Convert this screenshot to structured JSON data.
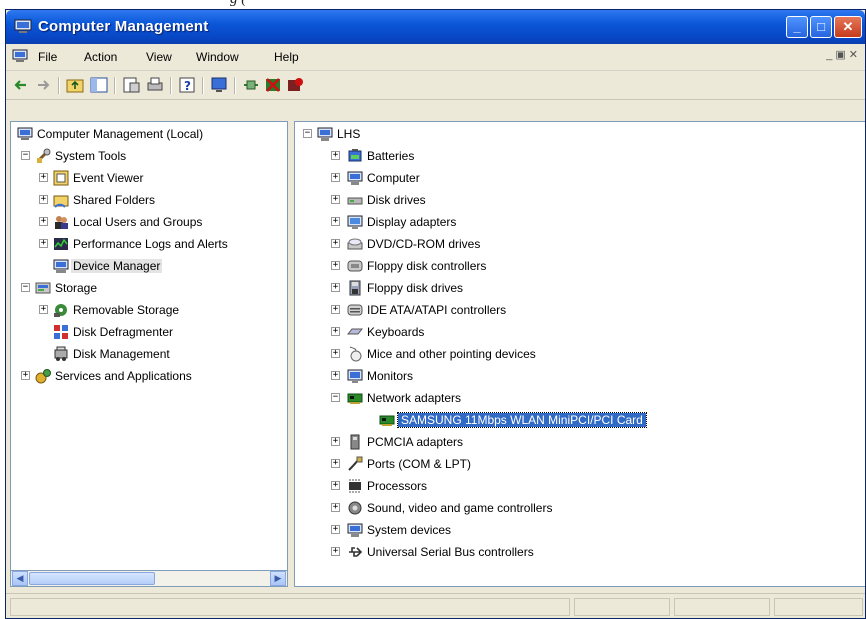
{
  "window": {
    "title": "Computer Management"
  },
  "menu": [
    "File",
    "Action",
    "View",
    "Window",
    "Help"
  ],
  "toolbar_icons": [
    "back-icon",
    "forward-icon",
    "up-folder-icon",
    "show-hide-tree-icon",
    "properties-icon",
    "print-icon",
    "help-icon",
    "scan-hardware-icon",
    "update-driver-icon",
    "uninstall-icon",
    "disable-icon"
  ],
  "left_tree": [
    {
      "label": "Computer Management (Local)",
      "icon": "computer-management-icon",
      "expander": ""
    },
    {
      "label": "System Tools",
      "icon": "system-tools-icon",
      "expander": "−"
    },
    {
      "label": "Event Viewer",
      "icon": "event-viewer-icon",
      "expander": "+"
    },
    {
      "label": "Shared Folders",
      "icon": "shared-folders-icon",
      "expander": "+"
    },
    {
      "label": "Local Users and Groups",
      "icon": "users-icon",
      "expander": "+"
    },
    {
      "label": "Performance Logs and Alerts",
      "icon": "performance-icon",
      "expander": "+"
    },
    {
      "label": "Device Manager",
      "icon": "device-manager-icon",
      "expander": "",
      "selected": true
    },
    {
      "label": "Storage",
      "icon": "storage-icon",
      "expander": "−"
    },
    {
      "label": "Removable Storage",
      "icon": "removable-storage-icon",
      "expander": "+"
    },
    {
      "label": "Disk Defragmenter",
      "icon": "defrag-icon",
      "expander": ""
    },
    {
      "label": "Disk Management",
      "icon": "disk-management-icon",
      "expander": ""
    },
    {
      "label": "Services and Applications",
      "icon": "services-icon",
      "expander": "+"
    }
  ],
  "right_tree": [
    {
      "label": "LHS",
      "icon": "computer-icon",
      "expander": "−"
    },
    {
      "label": "Batteries",
      "icon": "battery-icon",
      "expander": "+"
    },
    {
      "label": "Computer",
      "icon": "computer-icon",
      "expander": "+"
    },
    {
      "label": "Disk drives",
      "icon": "disk-drive-icon",
      "expander": "+"
    },
    {
      "label": "Display adapters",
      "icon": "display-adapter-icon",
      "expander": "+"
    },
    {
      "label": "DVD/CD-ROM drives",
      "icon": "cdrom-icon",
      "expander": "+"
    },
    {
      "label": "Floppy disk controllers",
      "icon": "floppy-controller-icon",
      "expander": "+"
    },
    {
      "label": "Floppy disk drives",
      "icon": "floppy-drive-icon",
      "expander": "+"
    },
    {
      "label": "IDE ATA/ATAPI controllers",
      "icon": "ide-controller-icon",
      "expander": "+"
    },
    {
      "label": "Keyboards",
      "icon": "keyboard-icon",
      "expander": "+"
    },
    {
      "label": "Mice and other pointing devices",
      "icon": "mouse-icon",
      "expander": "+"
    },
    {
      "label": "Monitors",
      "icon": "monitor-icon",
      "expander": "+"
    },
    {
      "label": "Network adapters",
      "icon": "network-adapter-icon",
      "expander": "−"
    },
    {
      "label": "SAMSUNG 11Mbps WLAN MiniPCI/PCI Card",
      "icon": "network-card-icon",
      "expander": "",
      "selected": true
    },
    {
      "label": "PCMCIA adapters",
      "icon": "pcmcia-icon",
      "expander": "+"
    },
    {
      "label": "Ports (COM & LPT)",
      "icon": "ports-icon",
      "expander": "+"
    },
    {
      "label": "Processors",
      "icon": "processor-icon",
      "expander": "+"
    },
    {
      "label": "Sound, video and game controllers",
      "icon": "sound-icon",
      "expander": "+"
    },
    {
      "label": "System devices",
      "icon": "system-devices-icon",
      "expander": "+"
    },
    {
      "label": "Universal Serial Bus controllers",
      "icon": "usb-icon",
      "expander": "+"
    }
  ],
  "colors": {
    "titlebar": "#0a57d9",
    "selection": "#316ac5",
    "chrome": "#ece9d8"
  }
}
